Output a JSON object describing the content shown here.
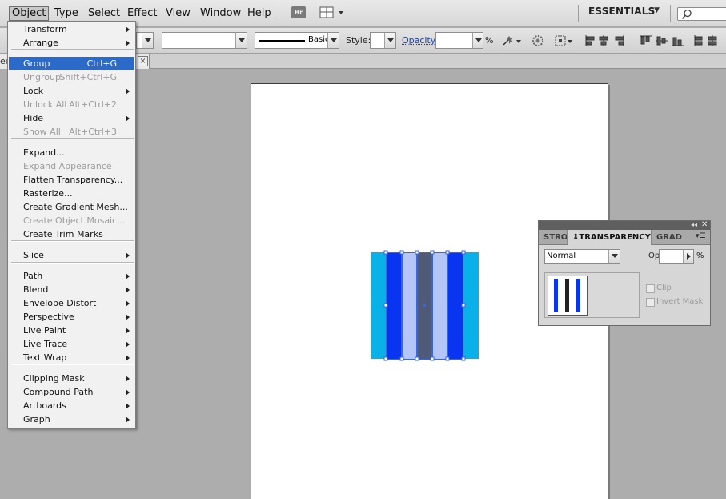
{
  "menubar": {
    "items": [
      "Object",
      "Type",
      "Select",
      "Effect",
      "View",
      "Window",
      "Help"
    ],
    "bridge_label": "Br",
    "workspace_label": "ESSENTIALS"
  },
  "controlbar": {
    "stroke_style_label": "Basic",
    "style_label": "Style:",
    "opacity_label": "Opacity:",
    "opacity_value": "",
    "percent_label": "%"
  },
  "document_tab": {
    "label": "ed",
    "close_label": "×"
  },
  "object_menu": {
    "items": [
      {
        "label": "Transform",
        "submenu": true
      },
      {
        "label": "Arrange",
        "submenu": true
      },
      {
        "label": "Group",
        "shortcut": "Ctrl+G",
        "highlight": true
      },
      {
        "label": "Ungroup",
        "shortcut": "Shift+Ctrl+G",
        "disabled": true
      },
      {
        "label": "Lock",
        "submenu": true
      },
      {
        "label": "Unlock All",
        "shortcut": "Alt+Ctrl+2",
        "disabled": true
      },
      {
        "label": "Hide",
        "submenu": true
      },
      {
        "label": "Show All",
        "shortcut": "Alt+Ctrl+3",
        "disabled": true
      },
      {
        "label": "Expand..."
      },
      {
        "label": "Expand Appearance",
        "disabled": true
      },
      {
        "label": "Flatten Transparency..."
      },
      {
        "label": "Rasterize..."
      },
      {
        "label": "Create Gradient Mesh..."
      },
      {
        "label": "Create Object Mosaic...",
        "disabled": true
      },
      {
        "label": "Create Trim Marks"
      },
      {
        "label": "Slice",
        "submenu": true
      },
      {
        "label": "Path",
        "submenu": true
      },
      {
        "label": "Blend",
        "submenu": true
      },
      {
        "label": "Envelope Distort",
        "submenu": true
      },
      {
        "label": "Perspective",
        "submenu": true
      },
      {
        "label": "Live Paint",
        "submenu": true
      },
      {
        "label": "Live Trace",
        "submenu": true
      },
      {
        "label": "Text Wrap",
        "submenu": true
      },
      {
        "label": "Clipping Mask",
        "submenu": true
      },
      {
        "label": "Compound Path",
        "submenu": true
      },
      {
        "label": "Artboards",
        "submenu": true
      },
      {
        "label": "Graph",
        "submenu": true
      }
    ]
  },
  "transparency_panel": {
    "tabs": [
      "STRO",
      "TRANSPARENCY",
      "GRAD"
    ],
    "active_tab": "TRANSPARENCY",
    "blend_mode": "Normal",
    "opacity_label": "Opacity:",
    "opacity_value": "",
    "percent_label": "%",
    "clip_label": "Clip",
    "invert_mask_label": "Invert Mask"
  },
  "colors": {
    "menu_highlight": "#2b6ac9",
    "cyan_stripe": "#0ab0e8",
    "blue_stripe": "#0a35f0",
    "light_stripe": "#b4c6f8",
    "dark_stripe": "#4e5a78",
    "selection": "#3a66d8"
  }
}
